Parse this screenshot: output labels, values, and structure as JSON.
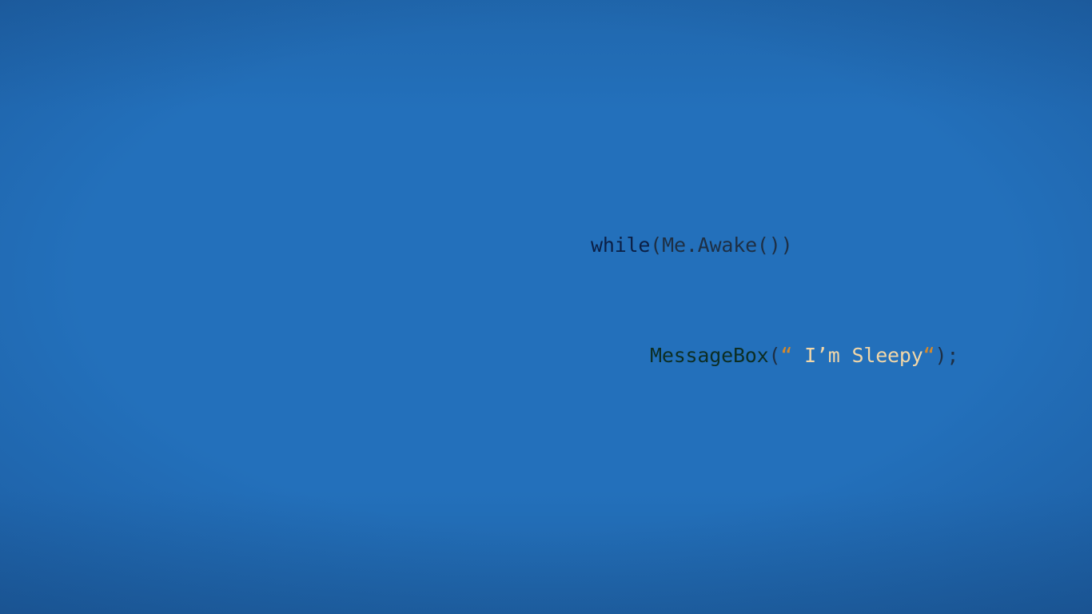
{
  "code": {
    "line1": {
      "keyword": "while",
      "rest": "(Me.Awake())"
    },
    "line2": {
      "function": "MessageBox",
      "open_paren": "(",
      "open_quote": "“",
      "string": " I’m Sleepy",
      "close_quote": "“",
      "close": ");"
    }
  },
  "colors": {
    "background": "#2370bb",
    "keyword": "#0b1f45",
    "function": "#0d2e24",
    "quote": "#d5892b",
    "string": "#f2d7a8"
  }
}
